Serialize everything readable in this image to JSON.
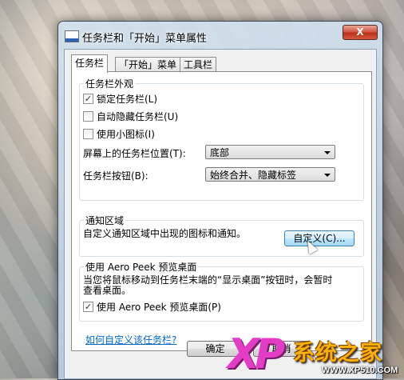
{
  "window": {
    "title": "任务栏和「开始」菜单属性",
    "close_symbol": "X"
  },
  "tabs": [
    {
      "label": "任务栏"
    },
    {
      "label": "「开始」菜单"
    },
    {
      "label": "工具栏"
    }
  ],
  "appearance": {
    "title": "任务栏外观",
    "lock_label": "锁定任务栏(L)",
    "lock_checked": true,
    "autohide_label": "自动隐藏任务栏(U)",
    "autohide_checked": false,
    "small_icons_label": "使用小图标(I)",
    "small_icons_checked": false,
    "position_label": "屏幕上的任务栏位置(T):",
    "position_value": "底部",
    "buttons_label": "任务栏按钮(B):",
    "buttons_value": "始终合并、隐藏标签"
  },
  "notification": {
    "title": "通知区域",
    "description": "自定义通知区域中出现的图标和通知。",
    "customize_button": "自定义(C)..."
  },
  "aero_peek": {
    "title": "使用 Aero Peek 预览桌面",
    "description_line1": "当您将鼠标移动到任务栏末端的“显示桌面”按钮时，会暂时",
    "description_line2": "查看桌面。",
    "checkbox_label": "使用 Aero Peek 预览桌面(P)",
    "checked": true
  },
  "help_link": "如何自定义该任务栏?",
  "footer": {
    "ok_button": "确定",
    "cancel_button": "取消"
  },
  "watermark": {
    "logo": "XP",
    "brand": "系统之家",
    "url": "WWW.XP510.COM"
  }
}
